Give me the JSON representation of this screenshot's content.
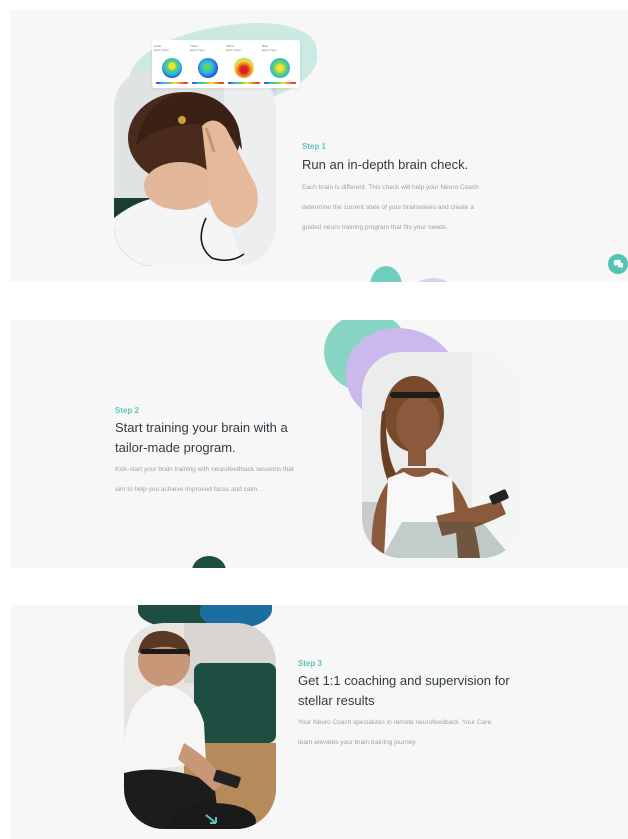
{
  "steps": [
    {
      "label": "Step 1",
      "title": "Run an in-depth brain check.",
      "description_lines": [
        "Each brain is different. This check will help your Neuro Coach",
        "determine the current state of your brainwaves and create a",
        "guided neuro training program that fits your needs."
      ]
    },
    {
      "label": "Step 2",
      "title_lines": [
        "Start training your brain with a",
        "tailor-made program."
      ],
      "description_lines": [
        "Kick-start your brain training with neurofeedback sessions that",
        "aim to help you achieve improved focus and calm."
      ]
    },
    {
      "label": "Step 3",
      "title_lines": [
        "Get 1:1 coaching and supervision for",
        "stellar results"
      ],
      "description_lines": [
        "Your Neuro Coach specializes in remote neurofeedback.  Your Care",
        "team elevates your brain training journey."
      ]
    }
  ],
  "brain_maps": [
    {
      "label_1": "Delta",
      "label_2": "Eyes Open"
    },
    {
      "label_1": "Theta",
      "label_2": "Eyes Open"
    },
    {
      "label_1": "Alpha",
      "label_2": "Eyes Open"
    },
    {
      "label_1": "Beta",
      "label_2": "Eyes Open"
    }
  ],
  "icons": {
    "chat": "chat-bubble-icon"
  },
  "colors": {
    "accent_teal": "#5ac8b9",
    "title_text": "#2f3b44",
    "body_text": "#9aa3a8",
    "blob_lavender": "#cbb9ec",
    "blob_mint": "#88d4c5",
    "blob_dark_green": "#1e4d42",
    "blob_blue": "#1c6ea0"
  }
}
